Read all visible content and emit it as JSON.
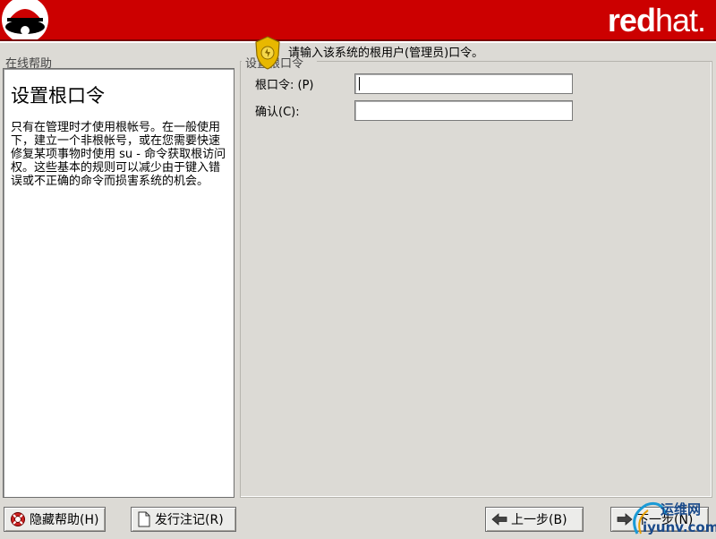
{
  "header": {
    "brand_bold": "red",
    "brand_light": "hat."
  },
  "help": {
    "section_label": "在线帮助",
    "title": "设置根口令",
    "text": "只有在管理时才使用根帐号。在一般使用下，建立一个非根帐号，或在您需要快速修复某项事物时使用 su - 命令获取根访问权。这些基本的规则可以减少由于键入错误或不正确的命令而损害系统的机会。"
  },
  "main": {
    "section_label": "设置根口令",
    "prompt": "请输入该系统的根用户(管理员)口令。",
    "root_label": "根口令: (P)",
    "confirm_label": "确认(C):",
    "root_value": "",
    "confirm_value": ""
  },
  "footer": {
    "hide_help": "隐藏帮助(H)",
    "release_notes": "发行注记(R)",
    "back": "上一步(B)",
    "next": "下一步(N)"
  },
  "watermark": {
    "top": "运维网",
    "bottom": "iyunv.com"
  },
  "colors": {
    "header": "#cc0000",
    "background": "#dcdad5"
  }
}
